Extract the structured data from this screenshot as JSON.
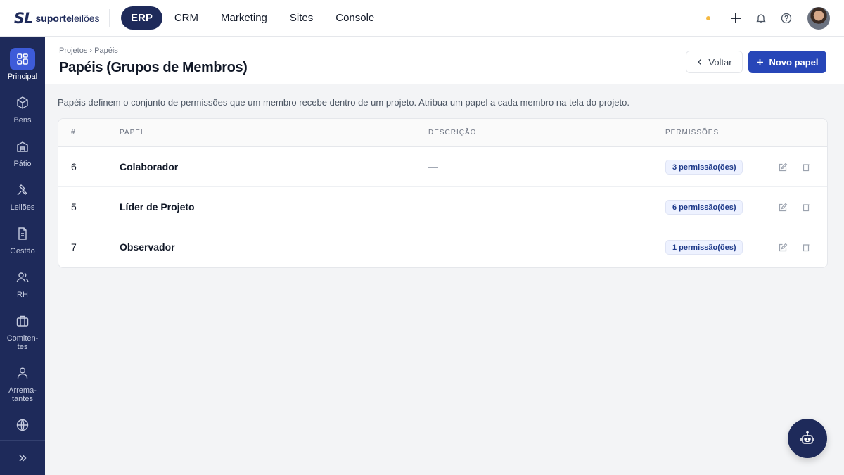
{
  "brand": {
    "mark": "SL",
    "name_bold": "suporte",
    "name_regular": "leilões"
  },
  "top_nav": [
    {
      "label": "ERP",
      "active": true
    },
    {
      "label": "CRM",
      "active": false
    },
    {
      "label": "Marketing",
      "active": false
    },
    {
      "label": "Sites",
      "active": false
    },
    {
      "label": "Console",
      "active": false
    }
  ],
  "top_icons": [
    "status-dot",
    "plus-icon",
    "bell-icon",
    "help-icon",
    "avatar"
  ],
  "sidebar": {
    "items": [
      {
        "label": "Principal",
        "icon": "grid-icon",
        "active": true
      },
      {
        "label": "Bens",
        "icon": "box-icon",
        "active": false
      },
      {
        "label": "Pátio",
        "icon": "warehouse-icon",
        "active": false
      },
      {
        "label": "Leilões",
        "icon": "gavel-icon",
        "active": false
      },
      {
        "label": "Gestão",
        "icon": "document-icon",
        "active": false
      },
      {
        "label": "RH",
        "icon": "users-icon",
        "active": false
      },
      {
        "label": "Comiten-\ntes",
        "icon": "briefcase-icon",
        "active": false
      },
      {
        "label": "Arrema-\ntantes",
        "icon": "user-icon",
        "active": false
      },
      {
        "label": "",
        "icon": "globe-icon",
        "active": false
      }
    ],
    "collapse_icon": "chevrons-right-icon"
  },
  "header": {
    "breadcrumb": "Projetos › Papéis",
    "title": "Papéis (Grupos de Membros)",
    "back_label": "Voltar",
    "new_label": "Novo papel"
  },
  "description": "Papéis definem o conjunto de permissões que um membro recebe dentro de um projeto. Atribua um papel a cada membro na tela do projeto.",
  "table": {
    "columns": [
      "#",
      "PAPEL",
      "DESCRIÇÃO",
      "PERMISSÕES"
    ],
    "rows": [
      {
        "id": "6",
        "name": "Colaborador",
        "description": "—",
        "permissions": "3 permissão(ões)"
      },
      {
        "id": "5",
        "name": "Líder de Projeto",
        "description": "—",
        "permissions": "6 permissão(ões)"
      },
      {
        "id": "7",
        "name": "Observador",
        "description": "—",
        "permissions": "1 permissão(ões)"
      }
    ]
  },
  "colors": {
    "navy": "#1e2a5a",
    "primary": "#2746b8",
    "active_side": "#3d5bd9",
    "badge_bg": "#eef2ff",
    "status_dot": "#f5b942"
  }
}
